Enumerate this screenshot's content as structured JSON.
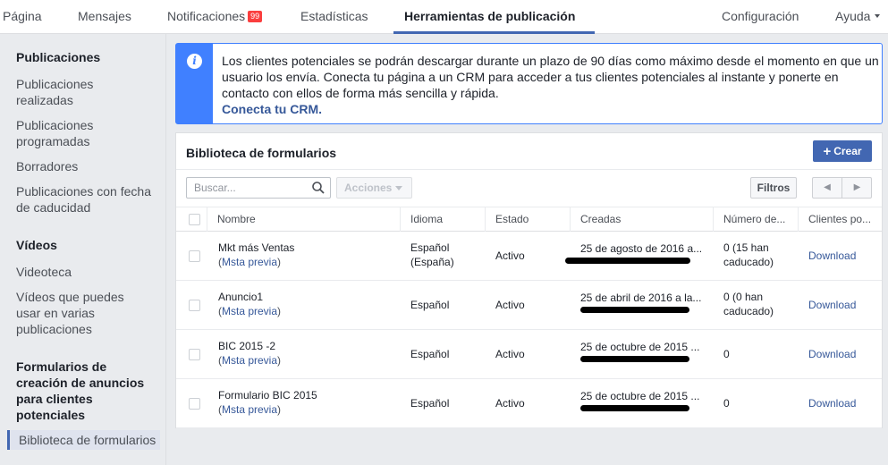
{
  "nav": {
    "tabs": [
      {
        "label": "Página"
      },
      {
        "label": "Mensajes"
      },
      {
        "label": "Notificaciones",
        "badge": "99"
      },
      {
        "label": "Estadísticas"
      },
      {
        "label": "Herramientas de publicación",
        "active": true
      }
    ],
    "right": {
      "config": "Configuración",
      "help": "Ayuda"
    },
    "accent_color": "#4267b2",
    "badge_color": "#fa3e3e"
  },
  "sidebar": {
    "sections": [
      {
        "title": "Publicaciones",
        "items": [
          "Publicaciones realizadas",
          "Publicaciones programadas",
          "Borradores",
          "Publicaciones con fecha de caducidad"
        ]
      },
      {
        "title": "Vídeos",
        "items": [
          "Videoteca",
          "Vídeos que puedes usar en varias publicaciones"
        ]
      },
      {
        "title": "Formularios de creación de anuncios para clientes potenciales",
        "items": [
          "Biblioteca de formularios"
        ],
        "selected": "Biblioteca de formularios"
      }
    ]
  },
  "info": {
    "icon": "info-icon",
    "text": "Los clientes potenciales se podrán descargar durante un plazo de 90 días como máximo desde el momento en que un usuario los envía. Conecta tu página a un CRM para acceder a tus clientes potenciales al instante y ponerte en contacto con ellos de forma más sencilla y rápida.",
    "link": "Conecta tu CRM.",
    "color": "#4080ff"
  },
  "library": {
    "title": "Biblioteca de formularios",
    "create_label": "Crear",
    "search_placeholder": "Buscar...",
    "actions_label": "Acciones",
    "filters_label": "Filtros",
    "columns": [
      "Nombre",
      "Idioma",
      "Estado",
      "Creadas",
      "Número de...",
      "Clientes po..."
    ],
    "rows": [
      {
        "name": "Mkt más Ventas",
        "preview": "Msta previa",
        "language": "Español (España)",
        "status": "Activo",
        "created": "25 de agosto de 2016 a...",
        "count": "0 (15 han caducado)",
        "download": "Download"
      },
      {
        "name": "Anuncio1",
        "preview": "Msta previa",
        "language": "Español",
        "status": "Activo",
        "created": "25 de abril de 2016 a la...",
        "count": "0 (0 han caducado)",
        "download": "Download"
      },
      {
        "name": "BIC 2015 -2",
        "preview": "Msta previa",
        "language": "Español",
        "status": "Activo",
        "created": "25 de octubre de 2015 ...",
        "count": "0",
        "download": "Download"
      },
      {
        "name": "Formulario BIC 2015",
        "preview": "Msta previa",
        "language": "Español",
        "status": "Activo",
        "created": "25 de octubre de 2015 ...",
        "count": "0",
        "download": "Download"
      }
    ]
  }
}
